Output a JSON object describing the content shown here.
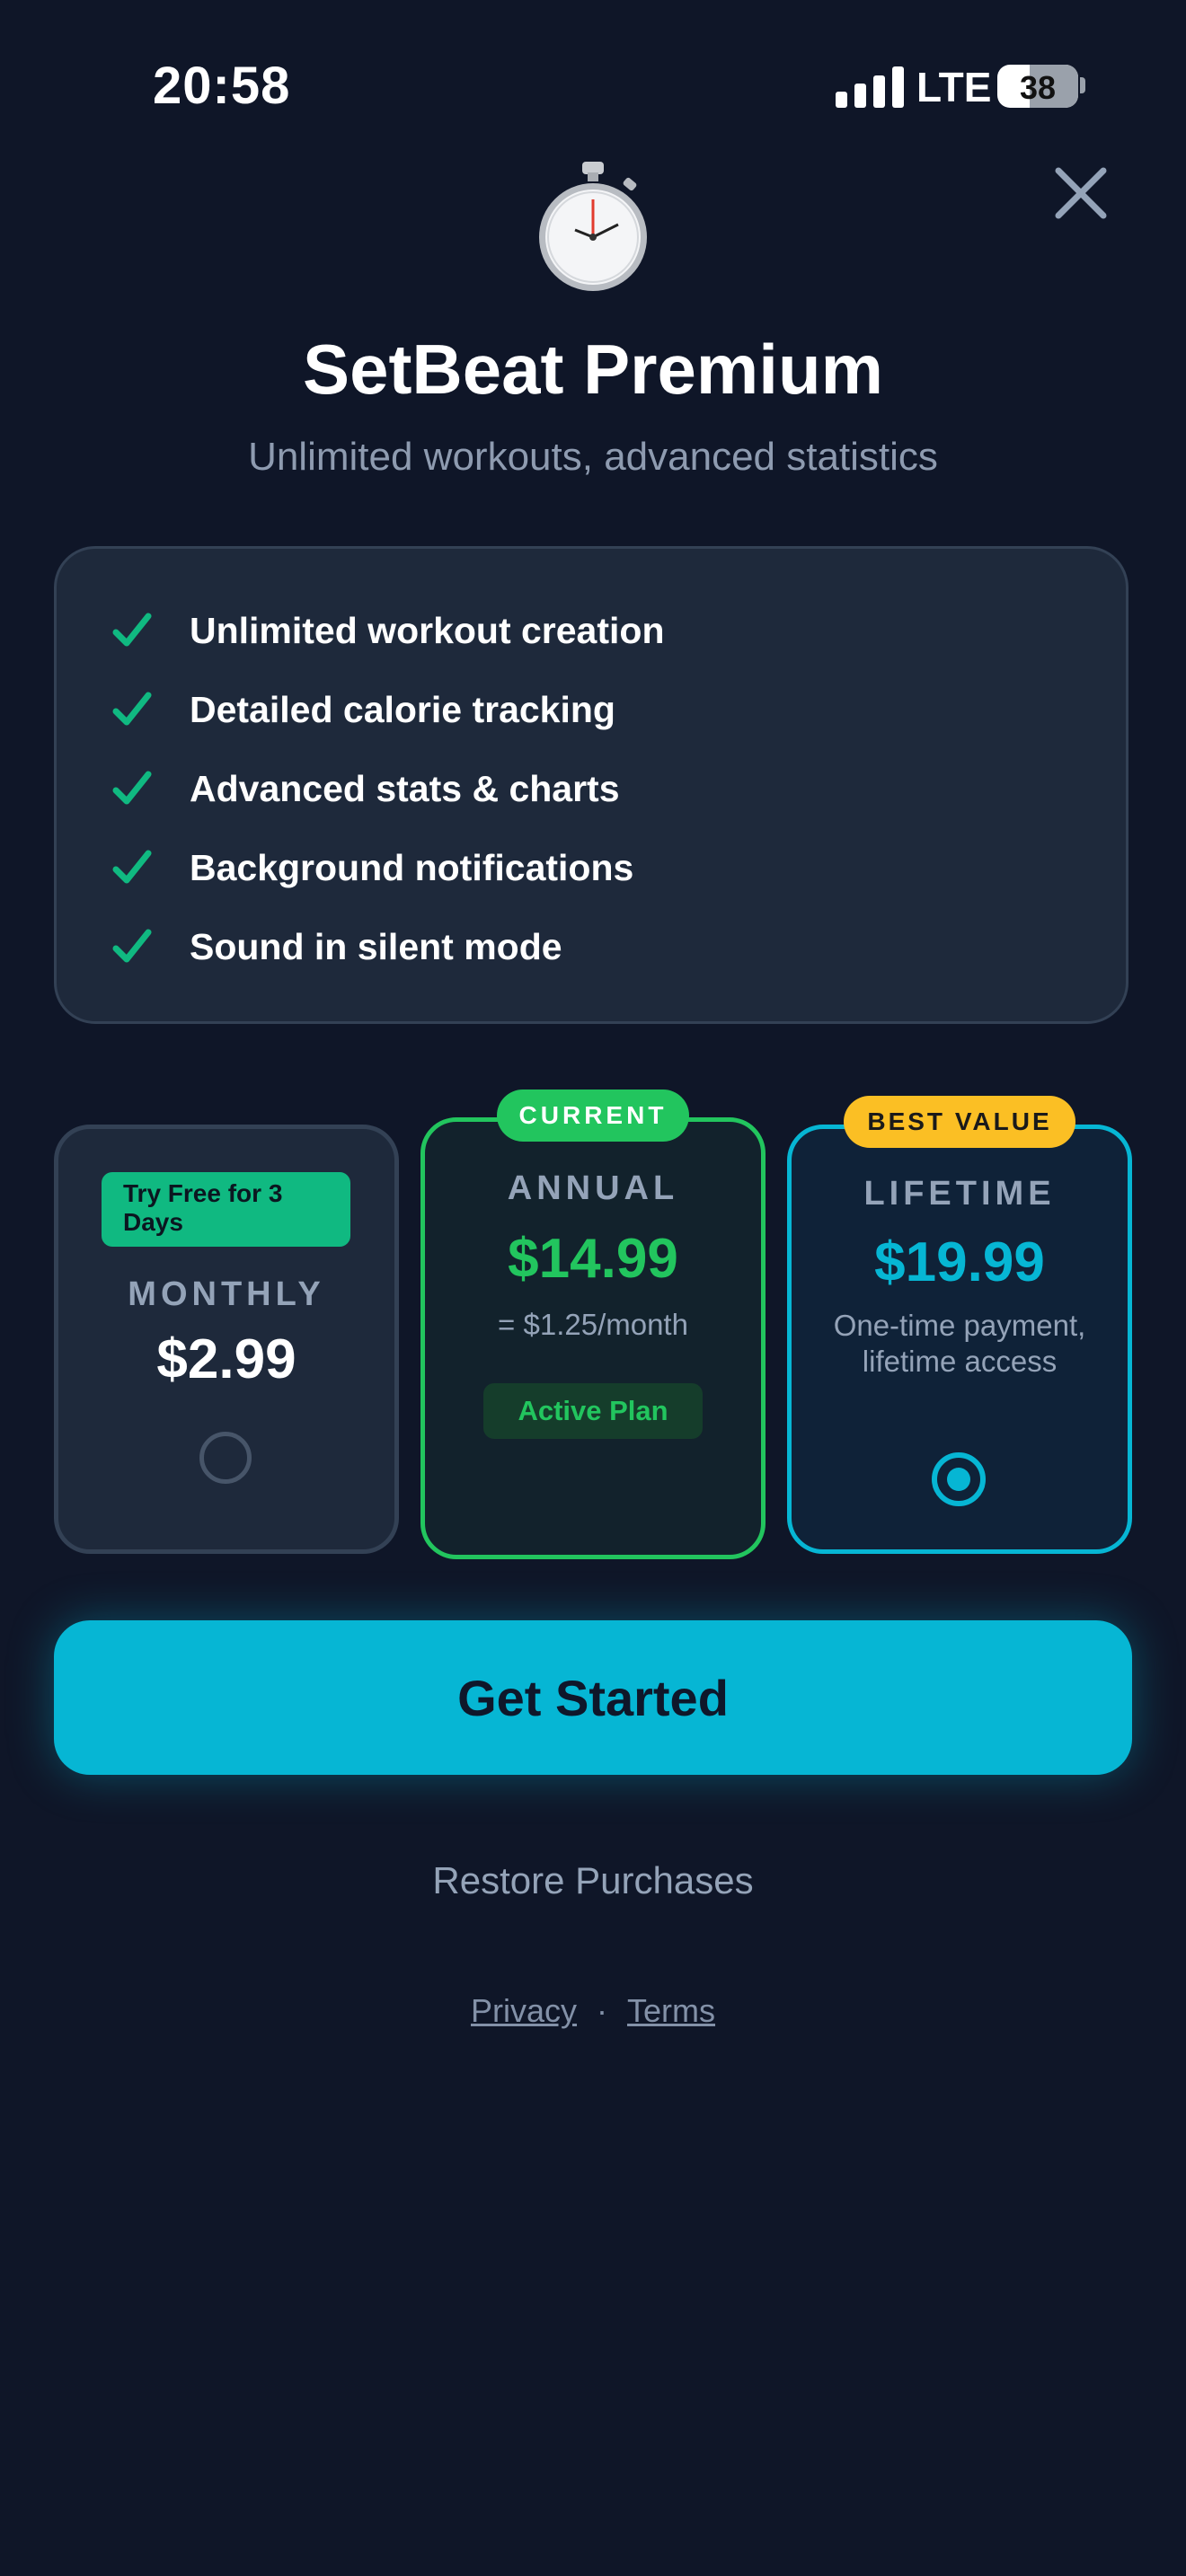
{
  "status_bar": {
    "time": "20:58",
    "network": "LTE",
    "battery": "38"
  },
  "header": {
    "title": "SetBeat Premium",
    "subtitle": "Unlimited workouts, advanced statistics",
    "icon": "stopwatch-icon",
    "close_icon": "close-icon"
  },
  "features": [
    {
      "label": "Unlimited workout creation"
    },
    {
      "label": "Detailed calorie tracking"
    },
    {
      "label": "Advanced stats & charts"
    },
    {
      "label": "Background notifications"
    },
    {
      "label": "Sound in silent mode"
    }
  ],
  "plans": {
    "monthly": {
      "badge": "Try Free for 3 Days",
      "name": "MONTHLY",
      "price": "$2.99",
      "selected": false
    },
    "annual": {
      "badge": "CURRENT",
      "name": "ANNUAL",
      "price": "$14.99",
      "per_month": "= $1.25/month",
      "status": "Active Plan"
    },
    "lifetime": {
      "badge": "BEST VALUE",
      "name": "LIFETIME",
      "price": "$19.99",
      "description": "One-time payment, lifetime access",
      "selected": true
    }
  },
  "cta": {
    "label": "Get Started"
  },
  "restore": {
    "label": "Restore Purchases"
  },
  "legal": {
    "privacy": "Privacy",
    "separator": "·",
    "terms": "Terms"
  },
  "colors": {
    "background": "#0f1628",
    "accent_cyan": "#06b6d4",
    "accent_green": "#22c55e",
    "badge_yellow": "#fbbf24"
  }
}
